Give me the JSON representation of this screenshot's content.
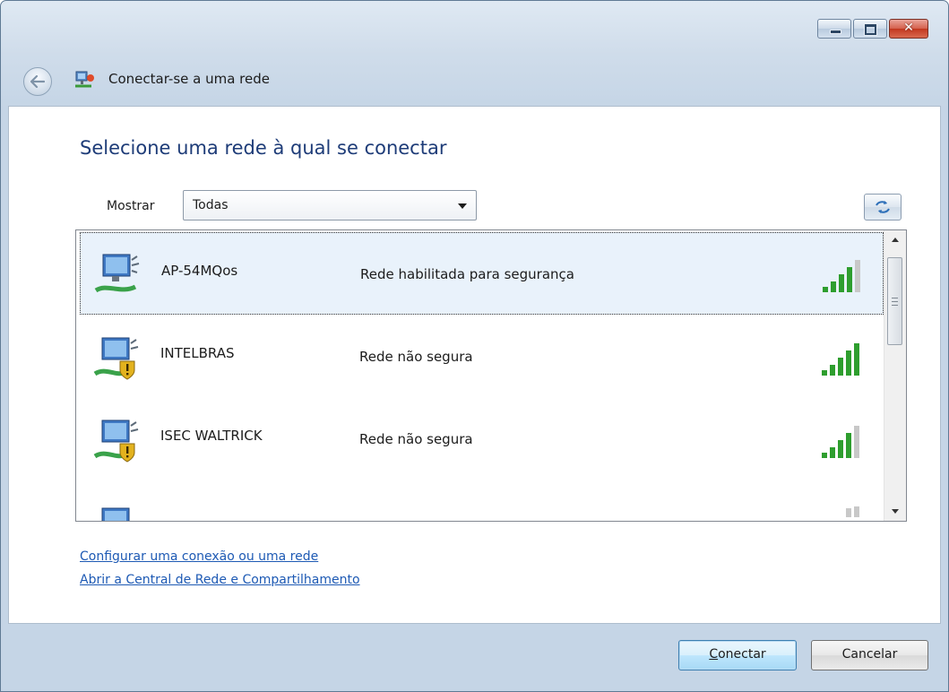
{
  "window": {
    "title": "Conectar-se a uma rede",
    "controls": [
      "minimize",
      "maximize",
      "close"
    ]
  },
  "heading": "Selecione uma rede à qual se conectar",
  "filter": {
    "label": "Mostrar",
    "selected": "Todas"
  },
  "networks": [
    {
      "name": "AP-54MQos",
      "status": "Rede habilitada para segurança",
      "secured": true,
      "selected": true,
      "signal_bars": 4
    },
    {
      "name": "INTELBRAS",
      "status": "Rede não segura",
      "secured": false,
      "selected": false,
      "signal_bars": 5
    },
    {
      "name": "ISEC WALTRICK",
      "status": "Rede não segura",
      "secured": false,
      "selected": false,
      "signal_bars": 4
    }
  ],
  "links": {
    "setup": "Configurar uma conexão ou uma rede",
    "center": "Abrir a Central de Rede e Compartilhamento"
  },
  "buttons": {
    "connect_underlined": "C",
    "connect_rest": "onectar",
    "cancel": "Cancelar"
  },
  "colors": {
    "heading": "#1e3c78",
    "link": "#1e5ab4",
    "signal_on": "#2e9e2e",
    "signal_off": "#c8c8c8",
    "selection": "#e9f2fb"
  }
}
